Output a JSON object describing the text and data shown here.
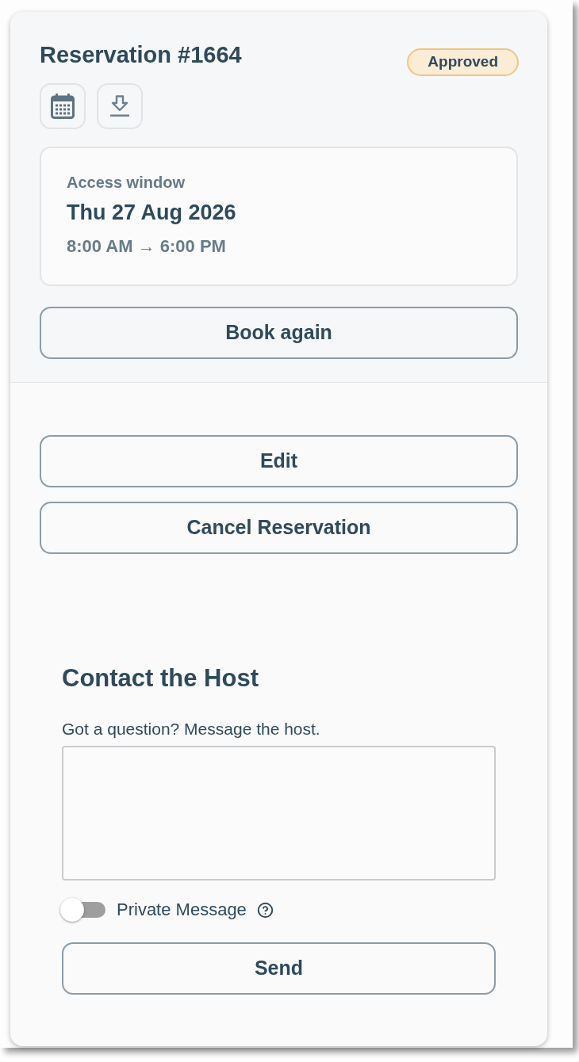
{
  "reservation": {
    "title": "Reservation #1664",
    "status": "Approved",
    "access_window": {
      "label": "Access window",
      "date": "Thu 27 Aug 2026",
      "time": "8:00 AM → 6:00 PM"
    },
    "book_again": "Book again"
  },
  "actions": [
    "Edit",
    "Cancel Reservation"
  ],
  "contact": {
    "title": "Contact the Host",
    "prompt": "Got a question? Message the host.",
    "private_message": {
      "label": "Private Message",
      "on": false
    },
    "send": "Send"
  }
}
